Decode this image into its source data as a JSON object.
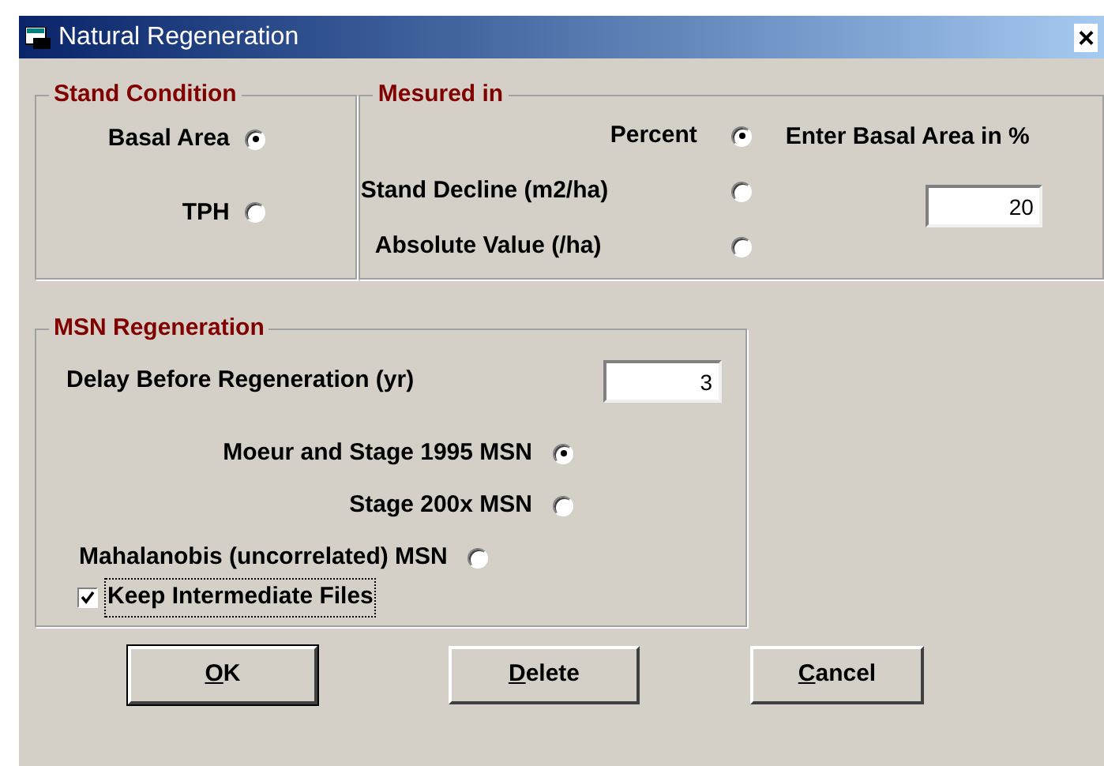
{
  "window": {
    "title": "Natural Regeneration",
    "close": "×"
  },
  "stand_condition": {
    "title": "Stand Condition",
    "options": [
      {
        "label": "Basal Area",
        "selected": true
      },
      {
        "label": "TPH",
        "selected": false
      }
    ]
  },
  "measured_in": {
    "title": "Mesured in",
    "options": [
      {
        "label": "Percent",
        "selected": true
      },
      {
        "label": "Stand Decline (m2/ha)",
        "selected": false
      },
      {
        "label": "Absolute Value (/ha)",
        "selected": false
      }
    ],
    "note": "Enter Basal Area  in %",
    "value": "20"
  },
  "msn_regeneration": {
    "title": "MSN Regeneration",
    "delay_label": "Delay Before Regeneration (yr)",
    "delay_value": "3",
    "options": [
      {
        "label": "Moeur and Stage 1995 MSN",
        "selected": true
      },
      {
        "label": "Stage 200x MSN",
        "selected": false
      },
      {
        "label": "Mahalanobis (uncorrelated) MSN",
        "selected": false
      }
    ],
    "keep_files": {
      "label": "Keep Intermediate Files",
      "checked": true
    }
  },
  "buttons": [
    {
      "label": "OK",
      "default": true
    },
    {
      "label": "Delete",
      "default": false
    },
    {
      "label": "Cancel",
      "default": false
    }
  ]
}
